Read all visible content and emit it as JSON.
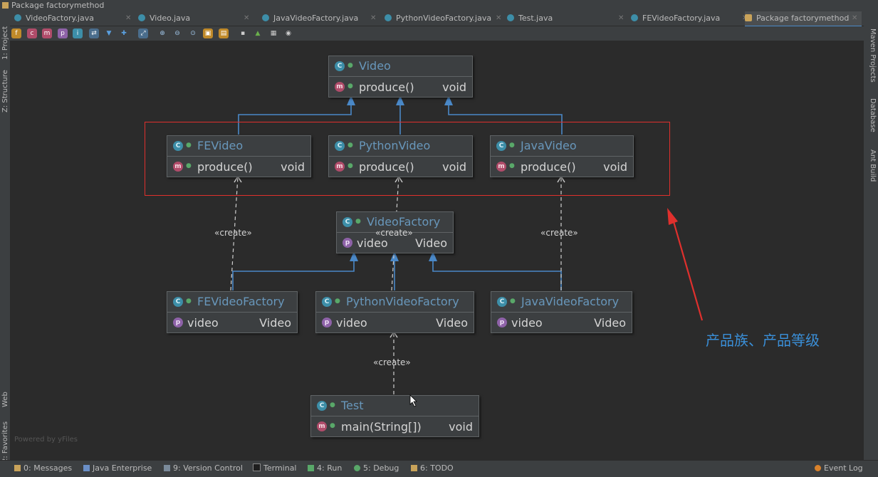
{
  "window": {
    "title": "Package factorymethod"
  },
  "tabs": [
    {
      "label": "VideoFactory.java"
    },
    {
      "label": "Video.java"
    },
    {
      "label": "JavaVideoFactory.java"
    },
    {
      "label": "PythonVideoFactory.java"
    },
    {
      "label": "Test.java"
    },
    {
      "label": "FEVideoFactory.java"
    },
    {
      "label": "Package factorymethod"
    }
  ],
  "left_strip": {
    "project": "1: Project",
    "structure": "Z: Structure",
    "web": "Web",
    "favorites": "2: Favorites"
  },
  "right_strip": {
    "maven": "Maven Projects",
    "database": "Database",
    "ant": "Ant Build"
  },
  "diagram": {
    "video": {
      "name": "Video",
      "method": "produce()",
      "type": "void"
    },
    "fevideo": {
      "name": "FEVideo",
      "method": "produce()",
      "type": "void"
    },
    "pythonvideo": {
      "name": "PythonVideo",
      "method": "produce()",
      "type": "void"
    },
    "javavideo": {
      "name": "JavaVideo",
      "method": "produce()",
      "type": "void"
    },
    "videofactory": {
      "name": "VideoFactory",
      "prop": "video",
      "type": "Video"
    },
    "fevideofactory": {
      "name": "FEVideoFactory",
      "prop": "video",
      "type": "Video"
    },
    "pythonvideofactory": {
      "name": "PythonVideoFactory",
      "prop": "video",
      "type": "Video"
    },
    "javavideofactory": {
      "name": "JavaVideoFactory",
      "prop": "video",
      "type": "Video"
    },
    "test": {
      "name": "Test",
      "method": "main(String[])",
      "type": "void"
    },
    "create_label": "«create»",
    "powered": "Powered by yFiles"
  },
  "annotation": "产品族、产品等级",
  "bottom": {
    "messages": "0: Messages",
    "java_enterprise": "Java Enterprise",
    "version_control": "9: Version Control",
    "terminal": "Terminal",
    "run": "4: Run",
    "debug": "5: Debug",
    "todo": "6: TODO",
    "event_log": "Event Log"
  },
  "colors": {
    "accent": "#4a88c7",
    "highlight": "#e0302d",
    "annotation": "#3a8fd8"
  }
}
